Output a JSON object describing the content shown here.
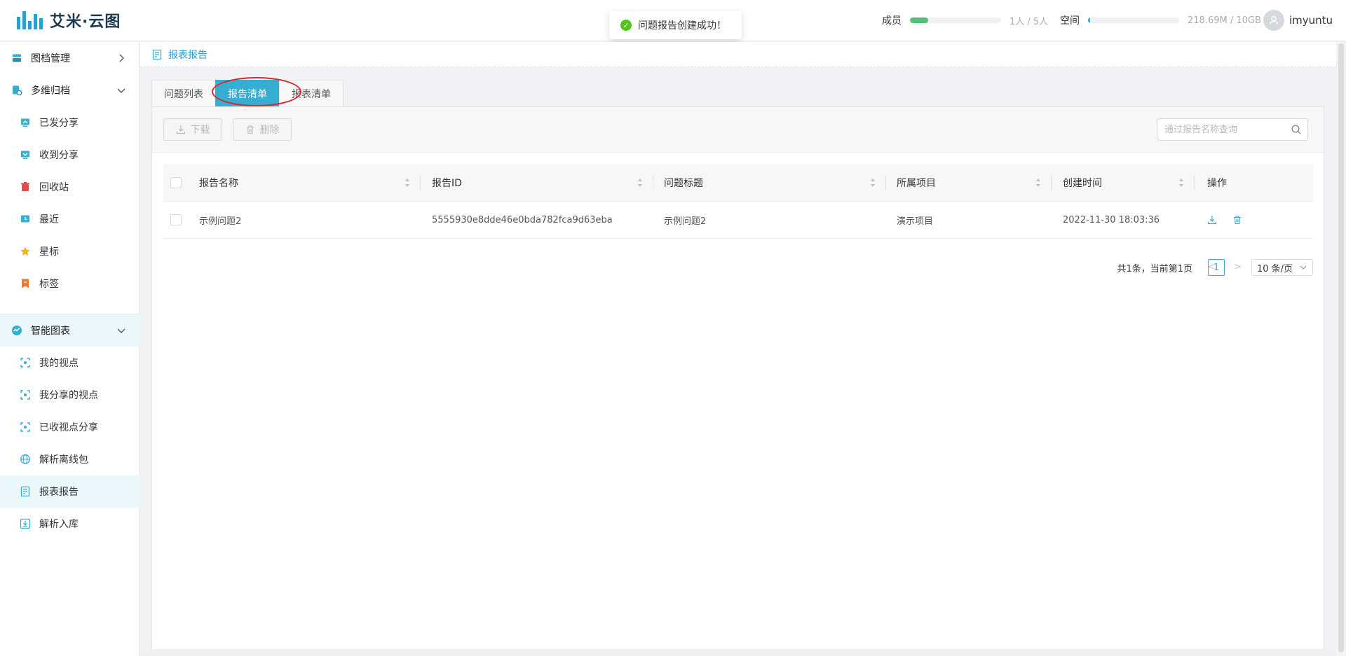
{
  "app": {
    "logo_text": "艾米·云图"
  },
  "toast": {
    "message": "问题报告创建成功！"
  },
  "header": {
    "members_label": "成员",
    "members_value": "1人 / 5人",
    "members_fraction": 0.2,
    "members_color": "#52c078",
    "space_label": "空间",
    "space_value": "218.69M / 10GB",
    "space_fraction": 0.02,
    "space_color": "#36aed3",
    "username": "imyuntu"
  },
  "sidebar": {
    "groups": [
      {
        "label": "图档管理",
        "icon": "archive-icon",
        "expanded": false
      },
      {
        "label": "多维归档",
        "icon": "multi-archive-icon",
        "expanded": true
      },
      {
        "label": "智能图表",
        "icon": "smart-chart-icon",
        "expanded": true
      }
    ],
    "archive_items": [
      {
        "label": "已发分享",
        "icon": "share-sent-icon"
      },
      {
        "label": "收到分享",
        "icon": "share-received-icon"
      },
      {
        "label": "回收站",
        "icon": "recycle-bin-icon"
      },
      {
        "label": "最近",
        "icon": "recent-icon"
      },
      {
        "label": "星标",
        "icon": "star-icon"
      },
      {
        "label": "标签",
        "icon": "tag-icon"
      }
    ],
    "chart_items": [
      {
        "label": "我的视点",
        "icon": "viewpoint-icon"
      },
      {
        "label": "我分享的视点",
        "icon": "viewpoint-icon"
      },
      {
        "label": "已收视点分享",
        "icon": "viewpoint-icon"
      },
      {
        "label": "解析离线包",
        "icon": "globe-icon"
      },
      {
        "label": "报表报告",
        "icon": "report-icon",
        "active": true
      },
      {
        "label": "解析入库",
        "icon": "import-icon"
      }
    ]
  },
  "breadcrumb": {
    "current": "报表报告"
  },
  "tabs": [
    {
      "label": "问题列表",
      "active": false
    },
    {
      "label": "报告清单",
      "active": true
    },
    {
      "label": "报表清单",
      "active": false
    }
  ],
  "toolbar": {
    "download_label": "下载",
    "delete_label": "删除",
    "search_placeholder": "通过报告名称查询"
  },
  "table": {
    "columns": [
      "报告名称",
      "报告ID",
      "问题标题",
      "所属项目",
      "创建时间",
      "操作"
    ],
    "rows": [
      {
        "name": "示例问题2",
        "id": "5555930e8dde46e0bda782fca9d63eba",
        "issue_title": "示例问题2",
        "project": "演示项目",
        "created": "2022-11-30 18:03:36"
      }
    ]
  },
  "pagination": {
    "summary": "共1条，当前第1页",
    "prev": "<",
    "current_page": "1",
    "next": ">",
    "page_size": "10 条/页"
  }
}
